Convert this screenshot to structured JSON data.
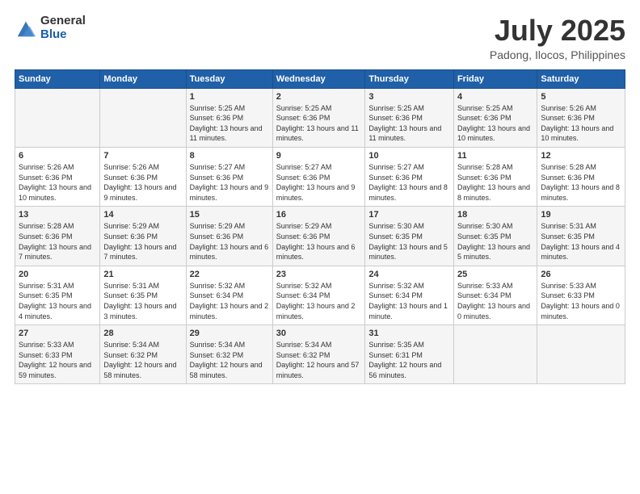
{
  "logo": {
    "general": "General",
    "blue": "Blue"
  },
  "header": {
    "month": "July 2025",
    "location": "Padong, Ilocos, Philippines"
  },
  "weekdays": [
    "Sunday",
    "Monday",
    "Tuesday",
    "Wednesday",
    "Thursday",
    "Friday",
    "Saturday"
  ],
  "weeks": [
    [
      {
        "day": "",
        "sunrise": "",
        "sunset": "",
        "daylight": ""
      },
      {
        "day": "",
        "sunrise": "",
        "sunset": "",
        "daylight": ""
      },
      {
        "day": "1",
        "sunrise": "Sunrise: 5:25 AM",
        "sunset": "Sunset: 6:36 PM",
        "daylight": "Daylight: 13 hours and 11 minutes."
      },
      {
        "day": "2",
        "sunrise": "Sunrise: 5:25 AM",
        "sunset": "Sunset: 6:36 PM",
        "daylight": "Daylight: 13 hours and 11 minutes."
      },
      {
        "day": "3",
        "sunrise": "Sunrise: 5:25 AM",
        "sunset": "Sunset: 6:36 PM",
        "daylight": "Daylight: 13 hours and 11 minutes."
      },
      {
        "day": "4",
        "sunrise": "Sunrise: 5:25 AM",
        "sunset": "Sunset: 6:36 PM",
        "daylight": "Daylight: 13 hours and 10 minutes."
      },
      {
        "day": "5",
        "sunrise": "Sunrise: 5:26 AM",
        "sunset": "Sunset: 6:36 PM",
        "daylight": "Daylight: 13 hours and 10 minutes."
      }
    ],
    [
      {
        "day": "6",
        "sunrise": "Sunrise: 5:26 AM",
        "sunset": "Sunset: 6:36 PM",
        "daylight": "Daylight: 13 hours and 10 minutes."
      },
      {
        "day": "7",
        "sunrise": "Sunrise: 5:26 AM",
        "sunset": "Sunset: 6:36 PM",
        "daylight": "Daylight: 13 hours and 9 minutes."
      },
      {
        "day": "8",
        "sunrise": "Sunrise: 5:27 AM",
        "sunset": "Sunset: 6:36 PM",
        "daylight": "Daylight: 13 hours and 9 minutes."
      },
      {
        "day": "9",
        "sunrise": "Sunrise: 5:27 AM",
        "sunset": "Sunset: 6:36 PM",
        "daylight": "Daylight: 13 hours and 9 minutes."
      },
      {
        "day": "10",
        "sunrise": "Sunrise: 5:27 AM",
        "sunset": "Sunset: 6:36 PM",
        "daylight": "Daylight: 13 hours and 8 minutes."
      },
      {
        "day": "11",
        "sunrise": "Sunrise: 5:28 AM",
        "sunset": "Sunset: 6:36 PM",
        "daylight": "Daylight: 13 hours and 8 minutes."
      },
      {
        "day": "12",
        "sunrise": "Sunrise: 5:28 AM",
        "sunset": "Sunset: 6:36 PM",
        "daylight": "Daylight: 13 hours and 8 minutes."
      }
    ],
    [
      {
        "day": "13",
        "sunrise": "Sunrise: 5:28 AM",
        "sunset": "Sunset: 6:36 PM",
        "daylight": "Daylight: 13 hours and 7 minutes."
      },
      {
        "day": "14",
        "sunrise": "Sunrise: 5:29 AM",
        "sunset": "Sunset: 6:36 PM",
        "daylight": "Daylight: 13 hours and 7 minutes."
      },
      {
        "day": "15",
        "sunrise": "Sunrise: 5:29 AM",
        "sunset": "Sunset: 6:36 PM",
        "daylight": "Daylight: 13 hours and 6 minutes."
      },
      {
        "day": "16",
        "sunrise": "Sunrise: 5:29 AM",
        "sunset": "Sunset: 6:36 PM",
        "daylight": "Daylight: 13 hours and 6 minutes."
      },
      {
        "day": "17",
        "sunrise": "Sunrise: 5:30 AM",
        "sunset": "Sunset: 6:35 PM",
        "daylight": "Daylight: 13 hours and 5 minutes."
      },
      {
        "day": "18",
        "sunrise": "Sunrise: 5:30 AM",
        "sunset": "Sunset: 6:35 PM",
        "daylight": "Daylight: 13 hours and 5 minutes."
      },
      {
        "day": "19",
        "sunrise": "Sunrise: 5:31 AM",
        "sunset": "Sunset: 6:35 PM",
        "daylight": "Daylight: 13 hours and 4 minutes."
      }
    ],
    [
      {
        "day": "20",
        "sunrise": "Sunrise: 5:31 AM",
        "sunset": "Sunset: 6:35 PM",
        "daylight": "Daylight: 13 hours and 4 minutes."
      },
      {
        "day": "21",
        "sunrise": "Sunrise: 5:31 AM",
        "sunset": "Sunset: 6:35 PM",
        "daylight": "Daylight: 13 hours and 3 minutes."
      },
      {
        "day": "22",
        "sunrise": "Sunrise: 5:32 AM",
        "sunset": "Sunset: 6:34 PM",
        "daylight": "Daylight: 13 hours and 2 minutes."
      },
      {
        "day": "23",
        "sunrise": "Sunrise: 5:32 AM",
        "sunset": "Sunset: 6:34 PM",
        "daylight": "Daylight: 13 hours and 2 minutes."
      },
      {
        "day": "24",
        "sunrise": "Sunrise: 5:32 AM",
        "sunset": "Sunset: 6:34 PM",
        "daylight": "Daylight: 13 hours and 1 minute."
      },
      {
        "day": "25",
        "sunrise": "Sunrise: 5:33 AM",
        "sunset": "Sunset: 6:34 PM",
        "daylight": "Daylight: 13 hours and 0 minutes."
      },
      {
        "day": "26",
        "sunrise": "Sunrise: 5:33 AM",
        "sunset": "Sunset: 6:33 PM",
        "daylight": "Daylight: 13 hours and 0 minutes."
      }
    ],
    [
      {
        "day": "27",
        "sunrise": "Sunrise: 5:33 AM",
        "sunset": "Sunset: 6:33 PM",
        "daylight": "Daylight: 12 hours and 59 minutes."
      },
      {
        "day": "28",
        "sunrise": "Sunrise: 5:34 AM",
        "sunset": "Sunset: 6:32 PM",
        "daylight": "Daylight: 12 hours and 58 minutes."
      },
      {
        "day": "29",
        "sunrise": "Sunrise: 5:34 AM",
        "sunset": "Sunset: 6:32 PM",
        "daylight": "Daylight: 12 hours and 58 minutes."
      },
      {
        "day": "30",
        "sunrise": "Sunrise: 5:34 AM",
        "sunset": "Sunset: 6:32 PM",
        "daylight": "Daylight: 12 hours and 57 minutes."
      },
      {
        "day": "31",
        "sunrise": "Sunrise: 5:35 AM",
        "sunset": "Sunset: 6:31 PM",
        "daylight": "Daylight: 12 hours and 56 minutes."
      },
      {
        "day": "",
        "sunrise": "",
        "sunset": "",
        "daylight": ""
      },
      {
        "day": "",
        "sunrise": "",
        "sunset": "",
        "daylight": ""
      }
    ]
  ]
}
